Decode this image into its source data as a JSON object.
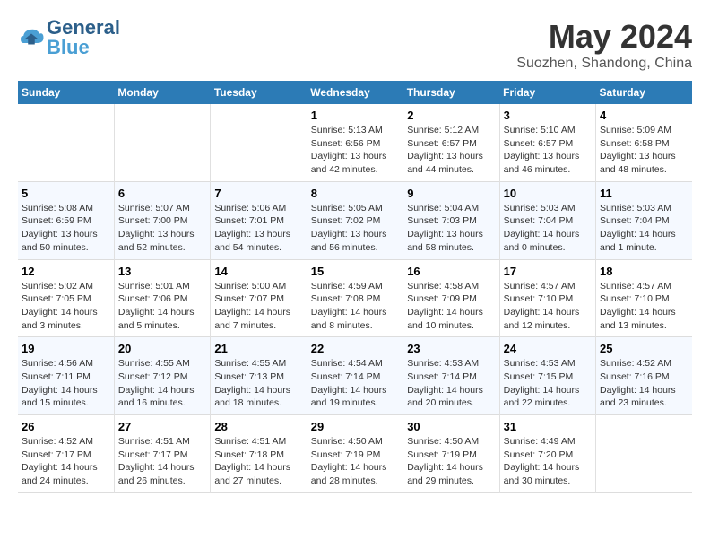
{
  "header": {
    "logo_general": "General",
    "logo_blue": "Blue",
    "month_title": "May 2024",
    "subtitle": "Suozhen, Shandong, China"
  },
  "days_of_week": [
    "Sunday",
    "Monday",
    "Tuesday",
    "Wednesday",
    "Thursday",
    "Friday",
    "Saturday"
  ],
  "weeks": [
    [
      {
        "day": "",
        "sunrise": "",
        "sunset": "",
        "daylight": ""
      },
      {
        "day": "",
        "sunrise": "",
        "sunset": "",
        "daylight": ""
      },
      {
        "day": "",
        "sunrise": "",
        "sunset": "",
        "daylight": ""
      },
      {
        "day": "1",
        "sunrise": "Sunrise: 5:13 AM",
        "sunset": "Sunset: 6:56 PM",
        "daylight": "Daylight: 13 hours and 42 minutes."
      },
      {
        "day": "2",
        "sunrise": "Sunrise: 5:12 AM",
        "sunset": "Sunset: 6:57 PM",
        "daylight": "Daylight: 13 hours and 44 minutes."
      },
      {
        "day": "3",
        "sunrise": "Sunrise: 5:10 AM",
        "sunset": "Sunset: 6:57 PM",
        "daylight": "Daylight: 13 hours and 46 minutes."
      },
      {
        "day": "4",
        "sunrise": "Sunrise: 5:09 AM",
        "sunset": "Sunset: 6:58 PM",
        "daylight": "Daylight: 13 hours and 48 minutes."
      }
    ],
    [
      {
        "day": "5",
        "sunrise": "Sunrise: 5:08 AM",
        "sunset": "Sunset: 6:59 PM",
        "daylight": "Daylight: 13 hours and 50 minutes."
      },
      {
        "day": "6",
        "sunrise": "Sunrise: 5:07 AM",
        "sunset": "Sunset: 7:00 PM",
        "daylight": "Daylight: 13 hours and 52 minutes."
      },
      {
        "day": "7",
        "sunrise": "Sunrise: 5:06 AM",
        "sunset": "Sunset: 7:01 PM",
        "daylight": "Daylight: 13 hours and 54 minutes."
      },
      {
        "day": "8",
        "sunrise": "Sunrise: 5:05 AM",
        "sunset": "Sunset: 7:02 PM",
        "daylight": "Daylight: 13 hours and 56 minutes."
      },
      {
        "day": "9",
        "sunrise": "Sunrise: 5:04 AM",
        "sunset": "Sunset: 7:03 PM",
        "daylight": "Daylight: 13 hours and 58 minutes."
      },
      {
        "day": "10",
        "sunrise": "Sunrise: 5:03 AM",
        "sunset": "Sunset: 7:04 PM",
        "daylight": "Daylight: 14 hours and 0 minutes."
      },
      {
        "day": "11",
        "sunrise": "Sunrise: 5:03 AM",
        "sunset": "Sunset: 7:04 PM",
        "daylight": "Daylight: 14 hours and 1 minute."
      }
    ],
    [
      {
        "day": "12",
        "sunrise": "Sunrise: 5:02 AM",
        "sunset": "Sunset: 7:05 PM",
        "daylight": "Daylight: 14 hours and 3 minutes."
      },
      {
        "day": "13",
        "sunrise": "Sunrise: 5:01 AM",
        "sunset": "Sunset: 7:06 PM",
        "daylight": "Daylight: 14 hours and 5 minutes."
      },
      {
        "day": "14",
        "sunrise": "Sunrise: 5:00 AM",
        "sunset": "Sunset: 7:07 PM",
        "daylight": "Daylight: 14 hours and 7 minutes."
      },
      {
        "day": "15",
        "sunrise": "Sunrise: 4:59 AM",
        "sunset": "Sunset: 7:08 PM",
        "daylight": "Daylight: 14 hours and 8 minutes."
      },
      {
        "day": "16",
        "sunrise": "Sunrise: 4:58 AM",
        "sunset": "Sunset: 7:09 PM",
        "daylight": "Daylight: 14 hours and 10 minutes."
      },
      {
        "day": "17",
        "sunrise": "Sunrise: 4:57 AM",
        "sunset": "Sunset: 7:10 PM",
        "daylight": "Daylight: 14 hours and 12 minutes."
      },
      {
        "day": "18",
        "sunrise": "Sunrise: 4:57 AM",
        "sunset": "Sunset: 7:10 PM",
        "daylight": "Daylight: 14 hours and 13 minutes."
      }
    ],
    [
      {
        "day": "19",
        "sunrise": "Sunrise: 4:56 AM",
        "sunset": "Sunset: 7:11 PM",
        "daylight": "Daylight: 14 hours and 15 minutes."
      },
      {
        "day": "20",
        "sunrise": "Sunrise: 4:55 AM",
        "sunset": "Sunset: 7:12 PM",
        "daylight": "Daylight: 14 hours and 16 minutes."
      },
      {
        "day": "21",
        "sunrise": "Sunrise: 4:55 AM",
        "sunset": "Sunset: 7:13 PM",
        "daylight": "Daylight: 14 hours and 18 minutes."
      },
      {
        "day": "22",
        "sunrise": "Sunrise: 4:54 AM",
        "sunset": "Sunset: 7:14 PM",
        "daylight": "Daylight: 14 hours and 19 minutes."
      },
      {
        "day": "23",
        "sunrise": "Sunrise: 4:53 AM",
        "sunset": "Sunset: 7:14 PM",
        "daylight": "Daylight: 14 hours and 20 minutes."
      },
      {
        "day": "24",
        "sunrise": "Sunrise: 4:53 AM",
        "sunset": "Sunset: 7:15 PM",
        "daylight": "Daylight: 14 hours and 22 minutes."
      },
      {
        "day": "25",
        "sunrise": "Sunrise: 4:52 AM",
        "sunset": "Sunset: 7:16 PM",
        "daylight": "Daylight: 14 hours and 23 minutes."
      }
    ],
    [
      {
        "day": "26",
        "sunrise": "Sunrise: 4:52 AM",
        "sunset": "Sunset: 7:17 PM",
        "daylight": "Daylight: 14 hours and 24 minutes."
      },
      {
        "day": "27",
        "sunrise": "Sunrise: 4:51 AM",
        "sunset": "Sunset: 7:17 PM",
        "daylight": "Daylight: 14 hours and 26 minutes."
      },
      {
        "day": "28",
        "sunrise": "Sunrise: 4:51 AM",
        "sunset": "Sunset: 7:18 PM",
        "daylight": "Daylight: 14 hours and 27 minutes."
      },
      {
        "day": "29",
        "sunrise": "Sunrise: 4:50 AM",
        "sunset": "Sunset: 7:19 PM",
        "daylight": "Daylight: 14 hours and 28 minutes."
      },
      {
        "day": "30",
        "sunrise": "Sunrise: 4:50 AM",
        "sunset": "Sunset: 7:19 PM",
        "daylight": "Daylight: 14 hours and 29 minutes."
      },
      {
        "day": "31",
        "sunrise": "Sunrise: 4:49 AM",
        "sunset": "Sunset: 7:20 PM",
        "daylight": "Daylight: 14 hours and 30 minutes."
      },
      {
        "day": "",
        "sunrise": "",
        "sunset": "",
        "daylight": ""
      }
    ]
  ]
}
